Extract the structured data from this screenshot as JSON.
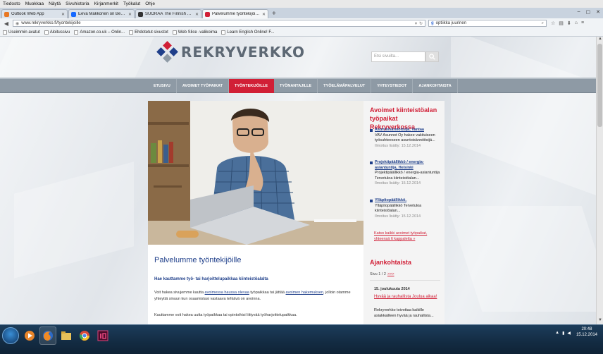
{
  "browser": {
    "menu": [
      "Tiedosto",
      "Muokkaa",
      "Näytä",
      "Sivuhistoria",
      "Kirjanmerkit",
      "Työkalut",
      "Ohje"
    ],
    "tabs": [
      {
        "label": "Outlook Web App",
        "color": "#e87722"
      },
      {
        "label": "Eeva Makkonen on Behance",
        "color": "#1769ff"
      },
      {
        "label": "SUORAA The Finnish Buildi...",
        "color": "#333333"
      },
      {
        "label": "Palvelumme työntekijöille | ...",
        "color": "#d11f36"
      }
    ],
    "new_tab": "+",
    "window_controls": [
      "–",
      "▢",
      "✕"
    ],
    "url": "www.rekryverkko.fi/tyontekijoille",
    "search": "optiikka juurinen",
    "bookmarks": [
      "Useimmin avatut",
      "Aloitussivu",
      "Amazon.co.uk – Onlin...",
      "Ehdotetut sivustot",
      "Web Slice -valikoima",
      "Learn English Online! F..."
    ]
  },
  "site": {
    "logo_text": "REKRYVERKKO",
    "search_placeholder": "Etsi sivuilta...",
    "nav": [
      "ETUSIVU",
      "AVOIMET TYÖPAIKAT",
      "TYÖNTEKIJÖILLE",
      "TYÖNANTAJILLE",
      "TYÖELÄMÄPALVELUT",
      "YHTEYSTIEDOT",
      "AJANKOHTAISTA"
    ],
    "nav_active_index": 2,
    "accent": "#d11f36",
    "link_color": "#1f3f8a"
  },
  "main": {
    "title": "Palvelumme työntekijöille",
    "subtitle": "Hae kauttamme työ- tai harjoittelupaikkaa kiinteistöalalta",
    "p1_a": "Voit hakea sivujemme kautta ",
    "p1_link1": "avoimessa haussa olevaa",
    "p1_b": " työpaikkaa tai jättää ",
    "p1_link2": "avoimen hakemuksen",
    "p1_c": ", jolloin otamme yhteyttä sinuun kun osaamistasi vastaava tehtävä on avoinna.",
    "p2": "Kauttamme voit hakea uutta työpaikkaa tai opintoihisi liittyvää työharjoittelupaikkaa."
  },
  "sidebar": {
    "title": "Avoimet kiinteistöalan työpaikat Rekryverkossa",
    "jobs": [
      {
        "title": "Asuntoisännöitsijä, Vantaa",
        "desc": "VAV Asunnot Oy hakee vakituiseen työsuhteeseen asuntoisännöitsijä...",
        "meta": "Ilmoitus lisätty: 15.12.2014"
      },
      {
        "title": "Projektipäällikkö / energia-asiantuntija, Helsinki",
        "desc": "Projektipäällikkö / energia-asiantuntija Tervetuloa kiinteistöalan...",
        "meta": "Ilmoitus lisätty: 15.12.2014"
      },
      {
        "title": "Ylläpitopäällikkö,",
        "desc": "Ylläpitopäällikkö Tervetuloa kiinteistöalan...",
        "meta": "Ilmoitus lisätty: 15.12.2014"
      }
    ],
    "all_jobs": "Katso kaikki avoimet työpaikat, yhteensä 6 kappaletta »",
    "news_title": "Ajankohtaista",
    "pager_text": "Sivu 1 / 2",
    "pager_next": ">>>",
    "news_date": "15. joulukuuta 2014",
    "news_headline": "Hyvää ja rauhallista Joulua aikaa!",
    "news_body": "Rekryverkko toivottaa kaikille asiakkailleen hyvää ja rauhallista..."
  },
  "taskbar": {
    "time": "20:48",
    "date": "15.12.2014"
  }
}
